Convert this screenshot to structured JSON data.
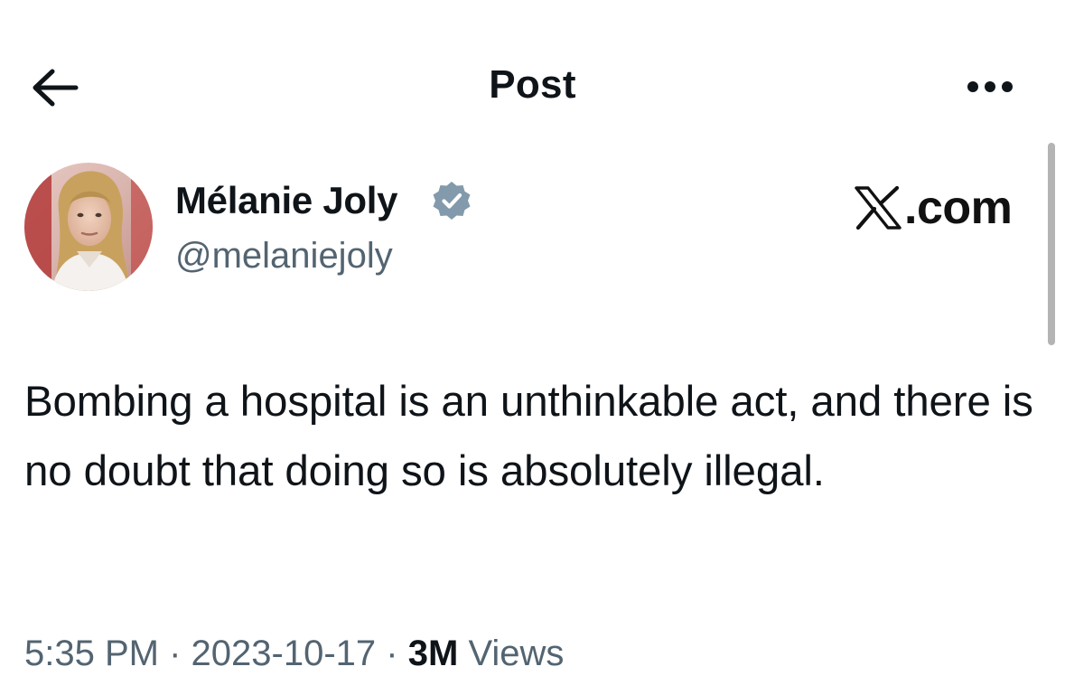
{
  "header": {
    "title": "Post",
    "back_icon": "arrow-left-icon",
    "more_icon": "more-horizontal-icon"
  },
  "post": {
    "author": {
      "name": "Mélanie Joly",
      "handle": "@melaniejoly",
      "verified_badge_color": "#829aab"
    },
    "text": "Bombing a hospital is an unthinkable act, and there is no doubt that doing so is absolutely illegal.",
    "meta": {
      "time": "5:35 PM",
      "separator": "·",
      "date": "2023-10-17",
      "views_count": "3M",
      "views_label": "Views"
    }
  },
  "watermark": {
    "logo_icon": "x-logo-icon",
    "text": ".com"
  },
  "colors": {
    "text_primary": "#0f1419",
    "text_secondary": "#536471",
    "background": "#ffffff"
  }
}
